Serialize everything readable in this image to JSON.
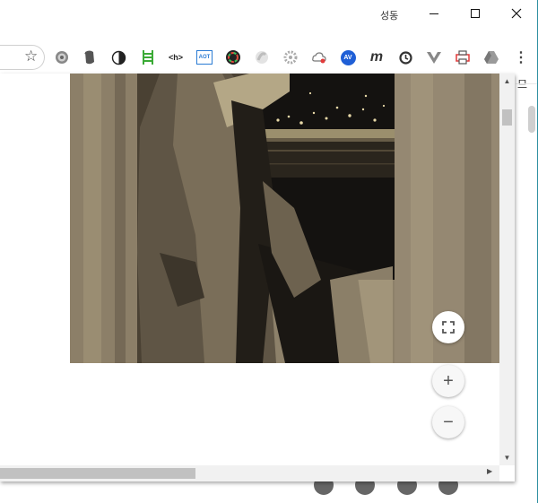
{
  "window": {
    "user_label": "성동"
  },
  "colors": {
    "frame": "#2d8ea0",
    "photo_tone": "#a8987a"
  },
  "extensions": [
    "gear-ext-icon",
    "evernote-icon",
    "contrast-icon",
    "ladder-icon",
    "h-tag-icon",
    "adblock-icon",
    "colorpicker-icon",
    "ghost-icon",
    "settings-ext-icon",
    "cloud-ext-icon",
    "avg-icon",
    "m-ext-icon",
    "sync-icon",
    "vue-icon",
    "printer-icon",
    "drive-icon",
    "menu-dots-icon"
  ],
  "ext_labels": {
    "h_tag": "<h>",
    "aot": "AOT",
    "m": "m",
    "av": "AV"
  },
  "right_strip": {
    "tab_char": "므"
  },
  "viewer": {
    "fullscreen_icon": "⛶",
    "zoom_in": "+",
    "zoom_out": "−"
  }
}
